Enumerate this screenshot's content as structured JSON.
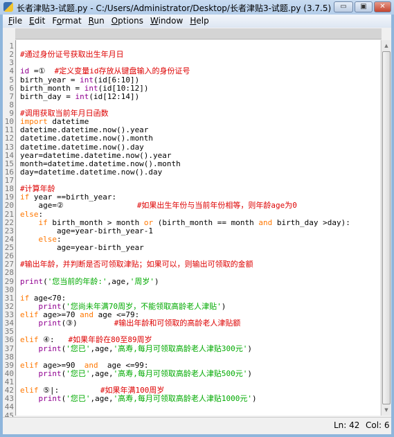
{
  "window": {
    "title": "长者津贴3-试题.py - C:/Users/Administrator/Desktop/长者津贴3-试题.py (3.7.5)",
    "minimize": "▭",
    "maximize": "▣",
    "close": "✕"
  },
  "menu": [
    {
      "u": "F",
      "rest": "ile"
    },
    {
      "u": "E",
      "rest": "dit"
    },
    {
      "pre": "F",
      "u": "o",
      "rest": "rmat"
    },
    {
      "u": "R",
      "rest": "un"
    },
    {
      "u": "O",
      "rest": "ptions"
    },
    {
      "u": "W",
      "rest": "indow"
    },
    {
      "u": "H",
      "rest": "elp"
    }
  ],
  "colors": {
    "keyword": "#ff7700",
    "builtin": "#900090",
    "string": "#00aa00",
    "comment": "#dd0000"
  },
  "code": [
    [],
    [
      [
        "c",
        "#通过身份证号获取出生年月日"
      ]
    ],
    [],
    [
      [
        "b",
        "id"
      ],
      [
        "n",
        " =①  "
      ],
      [
        "c",
        "#定义变量id存放从键盘输入的身份证号"
      ]
    ],
    [
      [
        "n",
        "birth_year = "
      ],
      [
        "b",
        "int"
      ],
      [
        "n",
        "(id[6:10])"
      ]
    ],
    [
      [
        "n",
        "birth_month = "
      ],
      [
        "b",
        "int"
      ],
      [
        "n",
        "(id[10:12])"
      ]
    ],
    [
      [
        "n",
        "birth_day = "
      ],
      [
        "b",
        "int"
      ],
      [
        "n",
        "(id[12:14])"
      ]
    ],
    [],
    [
      [
        "c",
        "#调用获取当前年月日函数"
      ]
    ],
    [
      [
        "k",
        "import"
      ],
      [
        "n",
        " datetime"
      ]
    ],
    [
      [
        "n",
        "datetime.datetime.now().year"
      ]
    ],
    [
      [
        "n",
        "datetime.datetime.now().month"
      ]
    ],
    [
      [
        "n",
        "datetime.datetime.now().day"
      ]
    ],
    [
      [
        "n",
        "year=datetime.datetime.now().year"
      ]
    ],
    [
      [
        "n",
        "month=datetime.datetime.now().month"
      ]
    ],
    [
      [
        "n",
        "day=datetime.datetime.now().day"
      ]
    ],
    [],
    [
      [
        "c",
        "#计算年龄"
      ]
    ],
    [
      [
        "k",
        "if"
      ],
      [
        "n",
        " year ==birth_year:"
      ]
    ],
    [
      [
        "n",
        "    age=②                "
      ],
      [
        "c",
        "#如果出生年份与当前年份相等，则年龄age为0"
      ]
    ],
    [
      [
        "k",
        "else"
      ],
      [
        "n",
        ":"
      ]
    ],
    [
      [
        "n",
        "    "
      ],
      [
        "k",
        "if"
      ],
      [
        "n",
        " birth_month > month "
      ],
      [
        "k",
        "or"
      ],
      [
        "n",
        " (birth_month == month "
      ],
      [
        "k",
        "and"
      ],
      [
        "n",
        " birth_day >day):"
      ]
    ],
    [
      [
        "n",
        "        age=year-birth_year-1"
      ]
    ],
    [
      [
        "n",
        "    "
      ],
      [
        "k",
        "else"
      ],
      [
        "n",
        ":"
      ]
    ],
    [
      [
        "n",
        "        age=year-birth_year"
      ]
    ],
    [],
    [
      [
        "c",
        "#输出年龄，并判断是否可领取津贴；如果可以，则输出可领取的金额"
      ]
    ],
    [],
    [
      [
        "b",
        "print"
      ],
      [
        "n",
        "("
      ],
      [
        "s",
        "'您当前的年龄:'"
      ],
      [
        "n",
        ",age,"
      ],
      [
        "s",
        "'周岁'"
      ],
      [
        "n",
        ")"
      ]
    ],
    [],
    [
      [
        "k",
        "if"
      ],
      [
        "n",
        " age<70:"
      ]
    ],
    [
      [
        "n",
        "    "
      ],
      [
        "b",
        "print"
      ],
      [
        "n",
        "("
      ],
      [
        "s",
        "'您尚未年满70周岁，不能领取高龄老人津贴'"
      ],
      [
        "n",
        ")"
      ]
    ],
    [
      [
        "k",
        "elif"
      ],
      [
        "n",
        " age>=70 "
      ],
      [
        "k",
        "and"
      ],
      [
        "n",
        " age <=79:"
      ]
    ],
    [
      [
        "n",
        "    "
      ],
      [
        "b",
        "print"
      ],
      [
        "n",
        "(③)        "
      ],
      [
        "c",
        "#输出年龄和可领取的高龄老人津贴额"
      ]
    ],
    [],
    [
      [
        "k",
        "elif"
      ],
      [
        "n",
        " ④:   "
      ],
      [
        "c",
        "#如果年龄在80至89周岁"
      ]
    ],
    [
      [
        "n",
        "    "
      ],
      [
        "b",
        "print"
      ],
      [
        "n",
        "("
      ],
      [
        "s",
        "'您已'"
      ],
      [
        "n",
        ",age,"
      ],
      [
        "s",
        "'高寿,每月可领取高龄老人津贴300元'"
      ],
      [
        "n",
        ")"
      ]
    ],
    [],
    [
      [
        "k",
        "elif"
      ],
      [
        "n",
        " age>=90  "
      ],
      [
        "k",
        "and"
      ],
      [
        "n",
        "  age <=99:"
      ]
    ],
    [
      [
        "n",
        "    "
      ],
      [
        "b",
        "print"
      ],
      [
        "n",
        "("
      ],
      [
        "s",
        "'您已'"
      ],
      [
        "n",
        ",age,"
      ],
      [
        "s",
        "'高寿,每月可领取高龄老人津贴500元'"
      ],
      [
        "n",
        ")"
      ]
    ],
    [],
    [
      [
        "k",
        "elif"
      ],
      [
        "n",
        " ⑤|:         "
      ],
      [
        "c",
        "#如果年满100周岁"
      ]
    ],
    [
      [
        "n",
        "    "
      ],
      [
        "b",
        "print"
      ],
      [
        "n",
        "("
      ],
      [
        "s",
        "'您已'"
      ],
      [
        "n",
        ",age,"
      ],
      [
        "s",
        "'高寿,每月可领取高龄老人津贴1000元'"
      ],
      [
        "n",
        ")"
      ]
    ],
    [],
    []
  ],
  "status": {
    "line": "Ln: 42",
    "col": "Col: 6"
  }
}
